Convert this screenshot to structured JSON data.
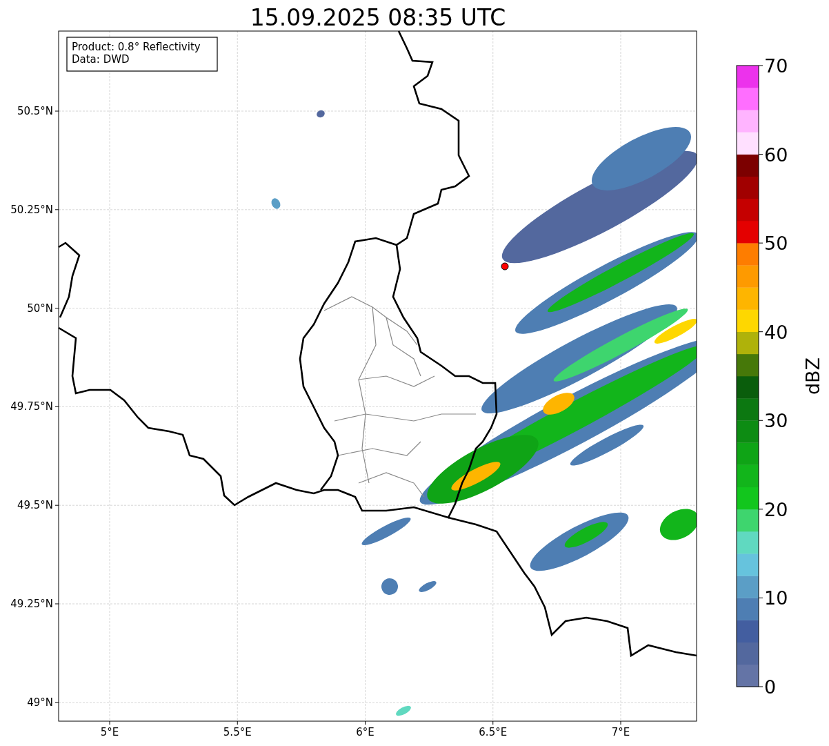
{
  "title": "15.09.2025 08:35 UTC",
  "info_box": {
    "lines": [
      "Product: 0.8° Reflectivity",
      "Data: DWD"
    ]
  },
  "x_ticks": [
    "5°E",
    "5.5°E",
    "6°E",
    "6.5°E",
    "7°E"
  ],
  "y_ticks": [
    "50.5°N",
    "50.25°N",
    "50°N",
    "49.75°N",
    "49.5°N",
    "49.25°N",
    "49°N"
  ],
  "colorbar": {
    "label": "dBZ",
    "ticks": [
      "70",
      "60",
      "50",
      "40",
      "30",
      "20",
      "10",
      "0"
    ],
    "bins": [
      {
        "color": "#6474a6"
      },
      {
        "color": "#53689e"
      },
      {
        "color": "#435ea0"
      },
      {
        "color": "#4e7eb3"
      },
      {
        "color": "#5b9ec6"
      },
      {
        "color": "#66c3dd"
      },
      {
        "color": "#60d9c0"
      },
      {
        "color": "#3ed56e"
      },
      {
        "color": "#12c61d"
      },
      {
        "color": "#12b51b"
      },
      {
        "color": "#0fa416"
      },
      {
        "color": "#0d8c13"
      },
      {
        "color": "#0c7811"
      },
      {
        "color": "#0a5d0c"
      },
      {
        "color": "#467809"
      },
      {
        "color": "#afb20a"
      },
      {
        "color": "#fed700"
      },
      {
        "color": "#feb500"
      },
      {
        "color": "#fe9a00"
      },
      {
        "color": "#fe7d00"
      },
      {
        "color": "#e40000"
      },
      {
        "color": "#c50000"
      },
      {
        "color": "#a10000"
      },
      {
        "color": "#7c0000"
      },
      {
        "color": "#ffe0ff"
      },
      {
        "color": "#ffb4ff"
      },
      {
        "color": "#ff6eff"
      },
      {
        "color": "#ec32ec"
      }
    ]
  }
}
